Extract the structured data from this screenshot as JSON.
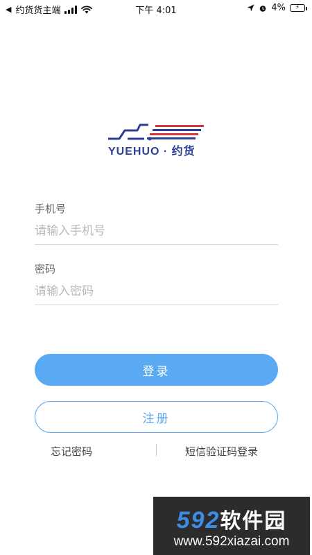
{
  "status_bar": {
    "back_app": "约货货主端",
    "time": "下午 4:01",
    "battery": "4%"
  },
  "logo": {
    "text": "YUEHUO · 约货",
    "colors": {
      "blue": "#2b3f95",
      "red": "#d9343b"
    }
  },
  "form": {
    "phone": {
      "label": "手机号",
      "placeholder": "请输入手机号",
      "value": ""
    },
    "password": {
      "label": "密码",
      "placeholder": "请输入密码",
      "value": ""
    }
  },
  "buttons": {
    "login": "登录",
    "register": "注册"
  },
  "links": {
    "forgot_password": "忘记密码",
    "sms_login": "短信验证码登录"
  },
  "watermark": {
    "number": "592",
    "chinese": "软件园",
    "url": "www.592xiazai.com"
  },
  "colors": {
    "accent": "#5aa9f3",
    "watermark_bg": "#2c2c2c",
    "watermark_blue": "#3c8de8"
  }
}
